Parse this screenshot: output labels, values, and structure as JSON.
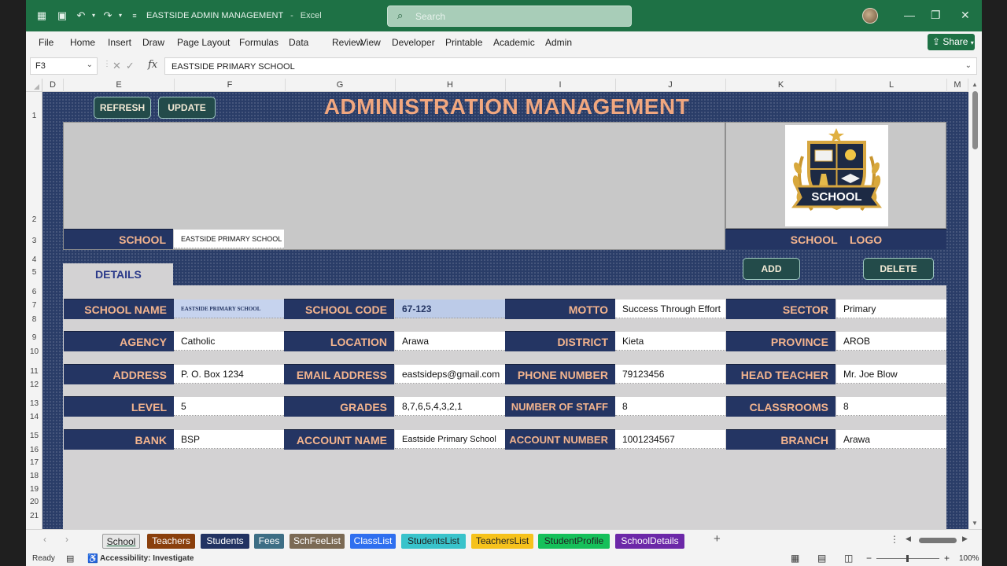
{
  "window": {
    "title": "EASTSIDE ADMIN MANAGEMENT",
    "separator": "-",
    "app_name": "Excel",
    "search_placeholder": "Search",
    "share_label": "Share"
  },
  "menu": [
    "File",
    "Home",
    "Insert",
    "Draw",
    "Page Layout",
    "Formulas",
    "Data",
    "Review",
    "View",
    "Developer",
    "Printable",
    "Academic",
    "Admin"
  ],
  "formula_bar": {
    "name_box": "F3",
    "fx": "fx",
    "content": "EASTSIDE PRIMARY SCHOOL"
  },
  "columns": [
    "D",
    "E",
    "F",
    "G",
    "H",
    "I",
    "J",
    "K",
    "L",
    "M"
  ],
  "rows": [
    "1",
    "2",
    "3",
    "4",
    "5",
    "6",
    "7",
    "8",
    "9",
    "10",
    "11",
    "12",
    "13",
    "14",
    "15",
    "16",
    "17",
    "18",
    "19",
    "20",
    "21"
  ],
  "sheet": {
    "refresh_label": "REFRESH",
    "update_label": "UPDATE",
    "title": "ADMINISTRATION MANAGEMENT",
    "school_label": "SCHOOL",
    "school_value": "EASTSIDE PRIMARY SCHOOL",
    "logo_caption": "SCHOOL    LOGO",
    "logo_text": "SCHOOL",
    "details_tab": "DETAILS",
    "add_label": "ADD",
    "delete_label": "DELETE"
  },
  "fields": [
    [
      {
        "label": "SCHOOL NAME",
        "value": "EASTSIDE PRIMARY SCHOOL"
      },
      {
        "label": "SCHOOL CODE",
        "value": "67-123"
      },
      {
        "label": "MOTTO",
        "value": "Success Through Effort"
      },
      {
        "label": "SECTOR",
        "value": "Primary"
      }
    ],
    [
      {
        "label": "AGENCY",
        "value": "Catholic"
      },
      {
        "label": "LOCATION",
        "value": "Arawa"
      },
      {
        "label": "DISTRICT",
        "value": "Kieta"
      },
      {
        "label": "PROVINCE",
        "value": "AROB"
      }
    ],
    [
      {
        "label": "ADDRESS",
        "value": "P. O. Box 1234"
      },
      {
        "label": "EMAIL ADDRESS",
        "value": "eastsideps@gmail.com"
      },
      {
        "label": "PHONE NUMBER",
        "value": "79123456"
      },
      {
        "label": "HEAD TEACHER",
        "value": "Mr. Joe Blow"
      }
    ],
    [
      {
        "label": "LEVEL",
        "value": "5"
      },
      {
        "label": "GRADES",
        "value": "8,7,6,5,4,3,2,1"
      },
      {
        "label": "NUMBER OF STAFF",
        "value": "8"
      },
      {
        "label": "CLASSROOMS",
        "value": "8"
      }
    ],
    [
      {
        "label": "BANK",
        "value": "BSP"
      },
      {
        "label": "ACCOUNT NAME",
        "value": "Eastside Primary School"
      },
      {
        "label": "ACCOUNT NUMBER",
        "value": "1001234567"
      },
      {
        "label": "BRANCH",
        "value": "Arawa"
      }
    ]
  ],
  "tabs": [
    {
      "label": "School",
      "color": "#e6e6e6",
      "text": "#222222",
      "active": true
    },
    {
      "label": "Teachers",
      "color": "#8a3f0c",
      "text": "#ffffff"
    },
    {
      "label": "Students",
      "color": "#223362",
      "text": "#ffffff"
    },
    {
      "label": "Fees",
      "color": "#3d6e85",
      "text": "#ffffff"
    },
    {
      "label": "SchFeeList",
      "color": "#7b6a54",
      "text": "#ffffff"
    },
    {
      "label": "ClassList",
      "color": "#2f6fef",
      "text": "#ffffff"
    },
    {
      "label": "StudentsList",
      "color": "#39c3cb",
      "text": "#222222"
    },
    {
      "label": "TeachersList",
      "color": "#f6c21c",
      "text": "#222222"
    },
    {
      "label": "StudentProfile",
      "color": "#15c05a",
      "text": "#222222"
    },
    {
      "label": "SchoolDetails",
      "color": "#6c28a8",
      "text": "#ffffff"
    }
  ],
  "status": {
    "ready": "Ready",
    "accessibility": "Accessibility: Investigate",
    "zoom": "100%",
    "zoom_minus": "−",
    "zoom_plus": "+"
  },
  "colors": {
    "excel_green": "#1e7145",
    "sheet_bg": "#2a3d68",
    "label_bg": "#243563",
    "label_text": "#f3b48e",
    "title_text": "#f1a77f"
  }
}
